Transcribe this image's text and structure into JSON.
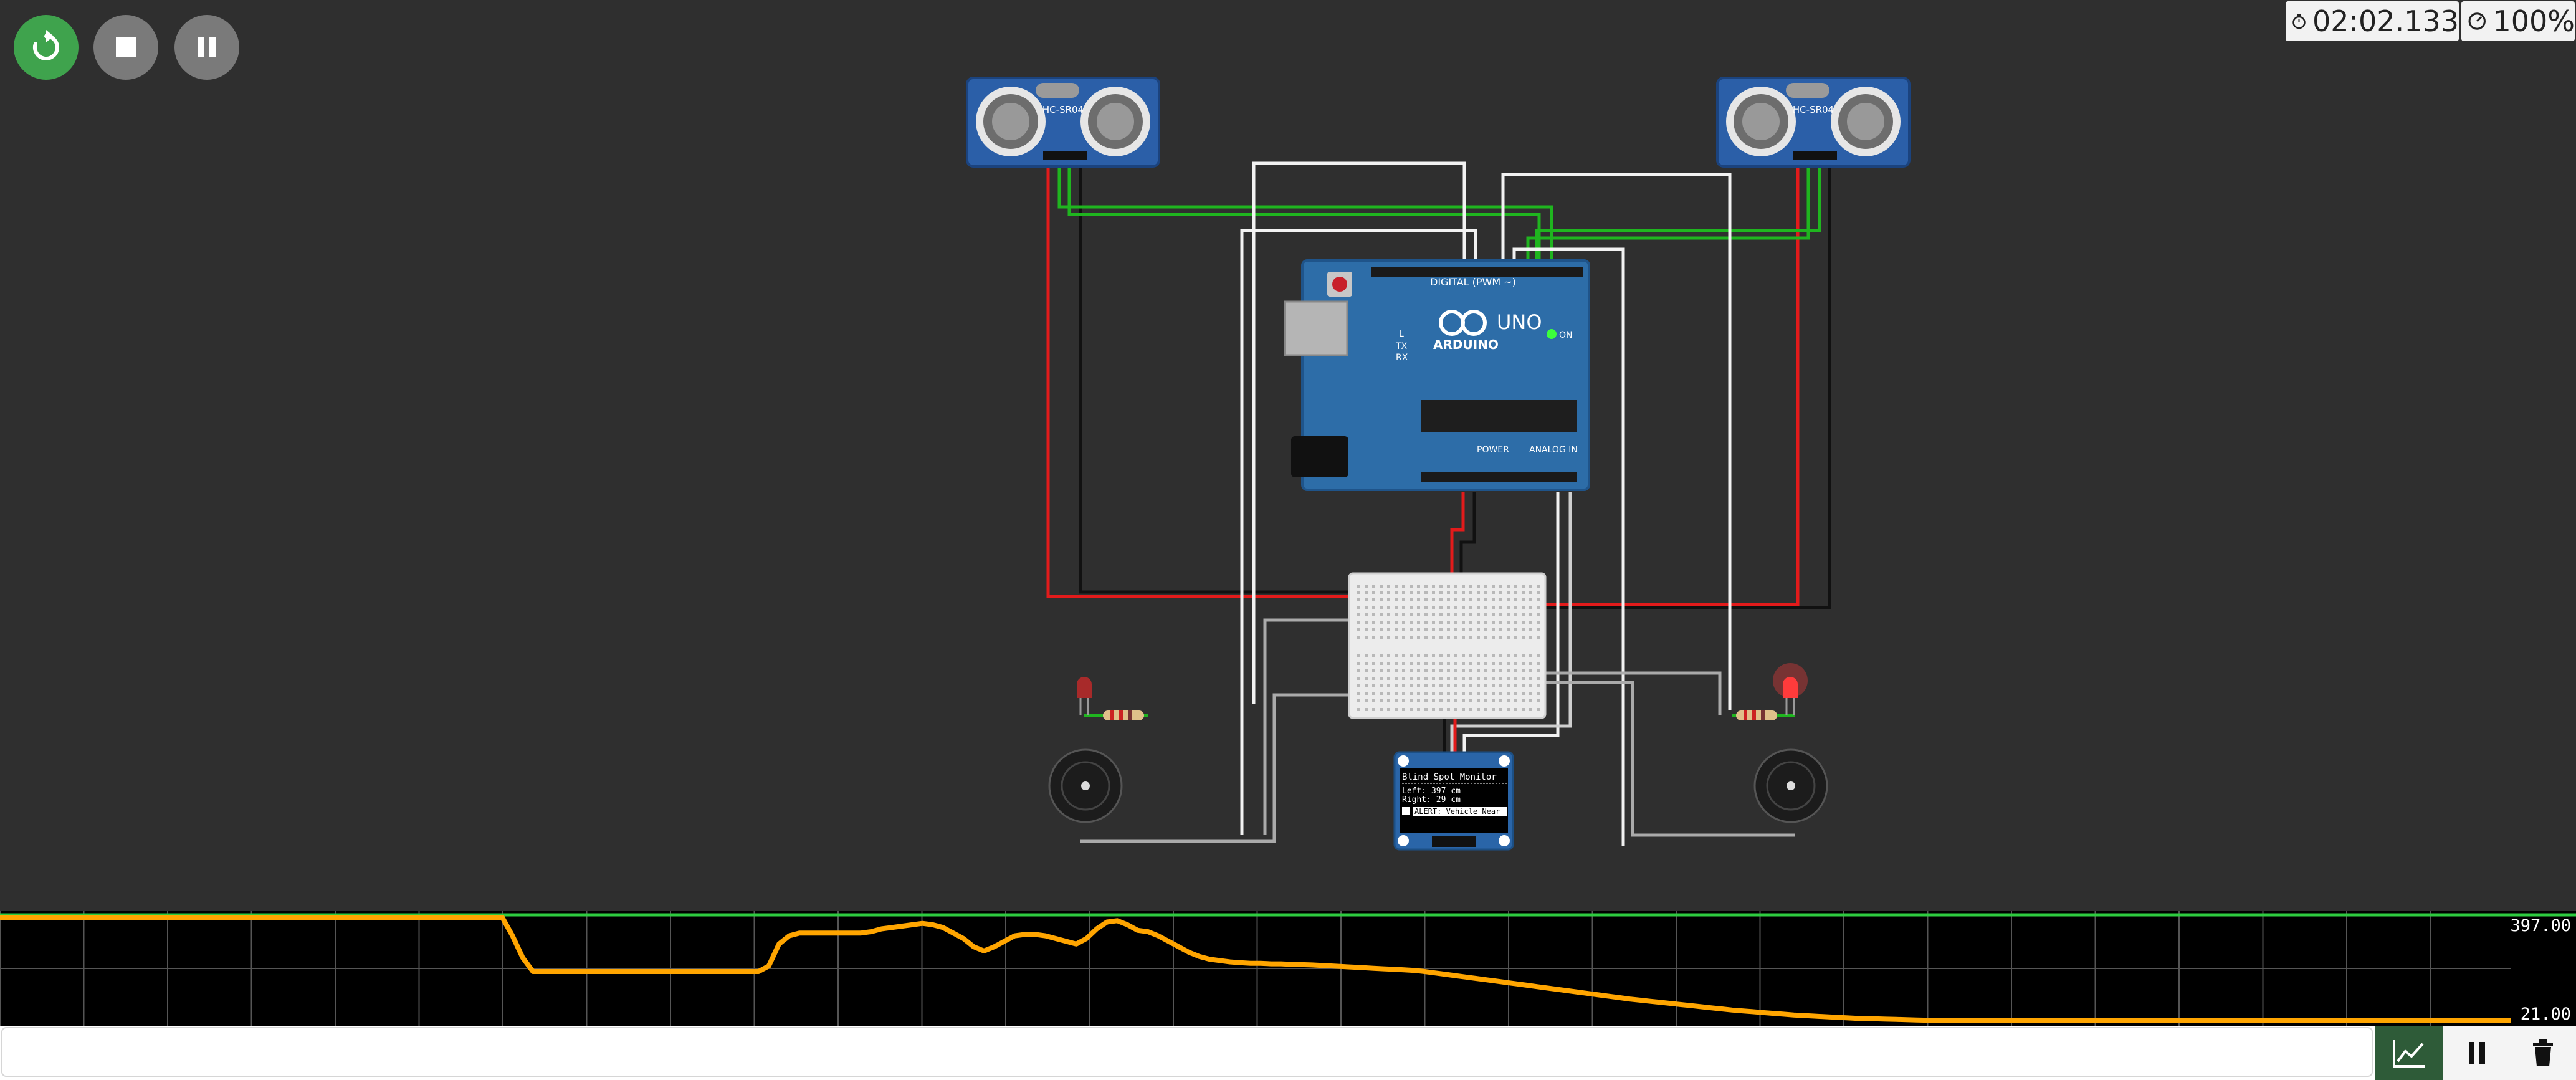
{
  "toolbar": {
    "restart_icon": "restart-icon",
    "stop_icon": "stop-icon",
    "pause_icon": "pause-icon",
    "accent": "#3fa34d"
  },
  "status": {
    "timer": "02:02.133",
    "speed": "100%"
  },
  "sensors": {
    "left_label": "HC-SR04",
    "right_label": "HC-SR04"
  },
  "arduino": {
    "brand": "ARDUINO",
    "model": "UNO",
    "digital_header": "DIGITAL (PWM ~)",
    "power_header": "POWER",
    "analog_header": "ANALOG IN",
    "on_label": "ON",
    "tx_label": "TX",
    "rx_label": "RX",
    "l_label": "L"
  },
  "oled": {
    "title": "Blind Spot Monitor",
    "left_line": "Left: 397 cm",
    "right_line": "Right: 29 cm",
    "alert": "ALERT: Vehicle Near"
  },
  "leds": {
    "left_state": "off",
    "right_state": "on",
    "color": "#ff3b3b"
  },
  "plotter": {
    "max_label": "397.00",
    "min_label": "21.00",
    "series_color": "#ffa500",
    "values": [
      397,
      397,
      397,
      397,
      397,
      397,
      397,
      397,
      397,
      397,
      397,
      397,
      397,
      397,
      397,
      397,
      397,
      397,
      397,
      397,
      397,
      397,
      397,
      397,
      397,
      397,
      397,
      397,
      397,
      397,
      397,
      397,
      397,
      397,
      397,
      397,
      397,
      397,
      397,
      397,
      397,
      397,
      397,
      397,
      397,
      397,
      397,
      397,
      397,
      397,
      330,
      250,
      200,
      200,
      200,
      200,
      200,
      200,
      200,
      200,
      200,
      200,
      200,
      200,
      200,
      200,
      200,
      200,
      200,
      200,
      200,
      200,
      200,
      200,
      200,
      220,
      300,
      330,
      340,
      340,
      340,
      340,
      340,
      340,
      340,
      345,
      355,
      360,
      365,
      370,
      375,
      370,
      360,
      340,
      320,
      290,
      275,
      290,
      310,
      330,
      335,
      335,
      330,
      320,
      310,
      300,
      320,
      355,
      380,
      385,
      370,
      350,
      345,
      330,
      310,
      290,
      270,
      255,
      245,
      240,
      235,
      232,
      230,
      230,
      228,
      228,
      226,
      225,
      224,
      222,
      220,
      218,
      216,
      214,
      212,
      210,
      208,
      206,
      204,
      200,
      195,
      190,
      185,
      180,
      175,
      170,
      165,
      160,
      155,
      150,
      145,
      140,
      135,
      130,
      125,
      120,
      115,
      110,
      105,
      100,
      96,
      92,
      88,
      84,
      80,
      76,
      72,
      68,
      64,
      60,
      57,
      54,
      51,
      48,
      45,
      42,
      40,
      38,
      36,
      34,
      32,
      30,
      29,
      28,
      27,
      26,
      25,
      24,
      23,
      22,
      22,
      21,
      21,
      21,
      21,
      21,
      21,
      21,
      21,
      21,
      21,
      21,
      21,
      21,
      21,
      21,
      21,
      21,
      21,
      21,
      21,
      21,
      21,
      21,
      21,
      21,
      21,
      21,
      21,
      21,
      21,
      21,
      21,
      21,
      21,
      21,
      21,
      21,
      21,
      21,
      21,
      21,
      21,
      21,
      21,
      21,
      21,
      21,
      21,
      21,
      21,
      21,
      21,
      21,
      21,
      21
    ]
  },
  "serial": {
    "input_value": "",
    "plotter_icon": "chart-icon",
    "pause_icon": "pause-icon",
    "clear_icon": "trash-icon"
  }
}
